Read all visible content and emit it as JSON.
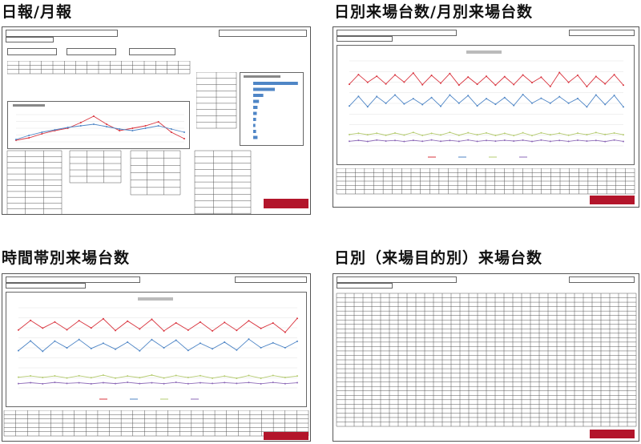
{
  "titles": {
    "daily_monthly": "日報/月報",
    "daily_monthly_chart": "日別来場台数/月別来場台数",
    "hourly": "時間帯別来場台数",
    "by_purpose": "日別（来場目的別）来場台数"
  },
  "colors": {
    "red_series": "#d9343e",
    "blue_series": "#4f86c6",
    "green_series": "#b6cc72",
    "purple_series": "#8e6bb8",
    "brand": "#b3152b"
  }
}
